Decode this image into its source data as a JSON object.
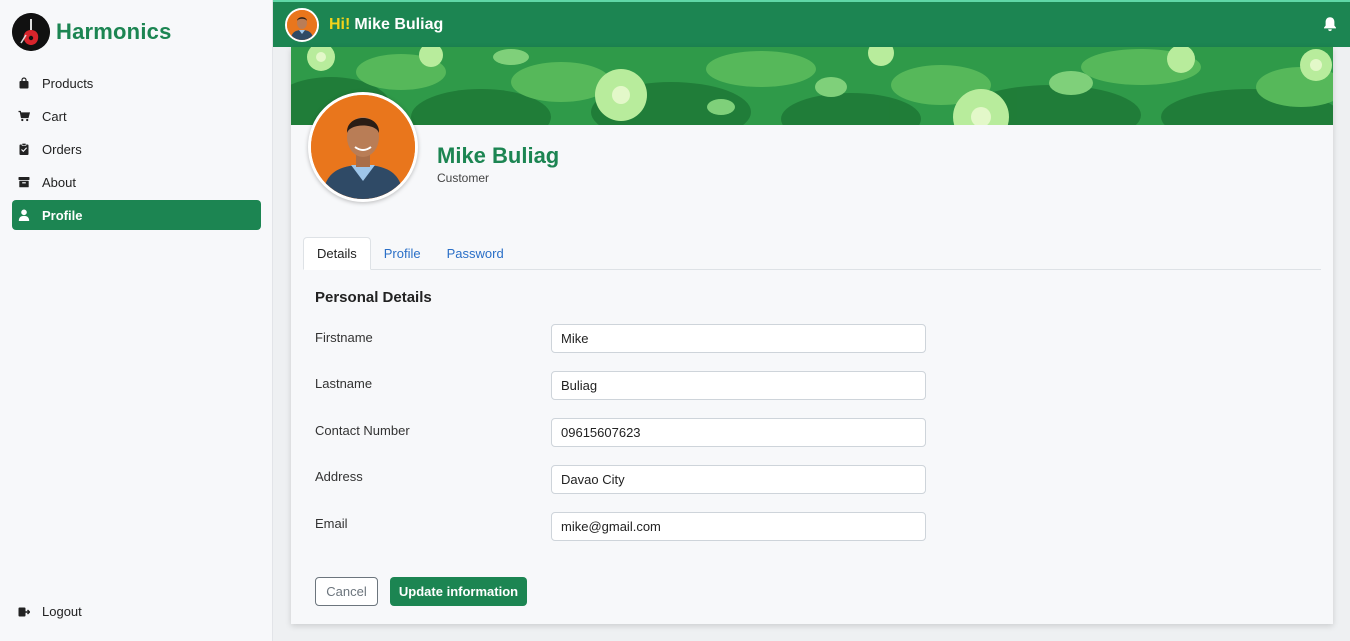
{
  "brand": {
    "name": "Harmonics",
    "logo_icon": "guitar-logo-icon"
  },
  "sidebar": {
    "items": [
      {
        "label": "Products",
        "icon": "shopping-bag-icon"
      },
      {
        "label": "Cart",
        "icon": "cart-icon"
      },
      {
        "label": "Orders",
        "icon": "clipboard-icon"
      },
      {
        "label": "About",
        "icon": "archive-icon"
      },
      {
        "label": "Profile",
        "icon": "user-icon",
        "active": true
      }
    ],
    "logout_label": "Logout"
  },
  "topbar": {
    "hi": "Hi!",
    "user_name": "Mike Buliag",
    "bell_icon": "bell-icon"
  },
  "profile": {
    "name": "Mike Buliag",
    "role": "Customer"
  },
  "tabs": [
    {
      "label": "Details",
      "active": true
    },
    {
      "label": "Profile"
    },
    {
      "label": "Password"
    }
  ],
  "form": {
    "title": "Personal Details",
    "fields": [
      {
        "label": "Firstname",
        "value": "Mike"
      },
      {
        "label": "Lastname",
        "value": "Buliag"
      },
      {
        "label": "Contact Number",
        "value": "09615607623"
      },
      {
        "label": "Address",
        "value": "Davao City"
      },
      {
        "label": "Email",
        "value": "mike@gmail.com"
      }
    ],
    "cancel_label": "Cancel",
    "update_label": "Update information"
  },
  "colors": {
    "primary": "#1c8552",
    "accent_yellow": "#f3d21b",
    "link": "#2a6fc7"
  }
}
